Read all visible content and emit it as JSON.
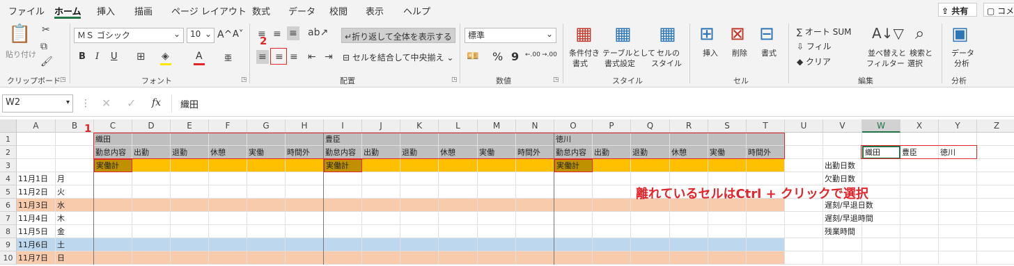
{
  "menu_tabs": [
    "ファイル",
    "ホーム",
    "挿入",
    "描画",
    "ページ レイアウト",
    "数式",
    "データ",
    "校閲",
    "表示",
    "ヘルプ"
  ],
  "share_label": "共有",
  "comment_label": "コメ",
  "ribbon": {
    "clipboard": {
      "paste": "貼り付け",
      "group": "クリップボード"
    },
    "font": {
      "name": "ＭＳ ゴシック",
      "size": "10",
      "group": "フォント",
      "grow": "A^",
      "shrink": "A˅",
      "bold": "B",
      "italic": "I",
      "underline": "U",
      "phonetic": "亜"
    },
    "alignment": {
      "wrap": "折り返して全体を表示する",
      "merge": "セルを結合して中央揃え",
      "group": "配置"
    },
    "number": {
      "format": "標準",
      "group": "数値",
      "percent": "%",
      "comma": "9",
      "inc": ".00",
      "dec": ".00"
    },
    "styles": {
      "cond": [
        "条件付き",
        "書式"
      ],
      "table": [
        "テーブルとして",
        "書式設定"
      ],
      "cell": [
        "セルの",
        "スタイル"
      ],
      "group": "スタイル"
    },
    "cells": {
      "insert": "挿入",
      "delete": "削除",
      "format": "書式",
      "group": "セル"
    },
    "editing": {
      "autosum": "オート SUM",
      "fill": "フィル",
      "clear": "クリア",
      "sort": [
        "並べ替えと",
        "フィルター"
      ],
      "find": [
        "検索と",
        "選択"
      ],
      "group": "編集"
    },
    "analysis": {
      "data": [
        "データ",
        "分析"
      ],
      "group": "分析"
    }
  },
  "annotations": {
    "step1": "1",
    "step2": "2",
    "note": "離れているセルはCtrl + クリックで選択"
  },
  "formula_bar": {
    "name_box": "W2",
    "fx": "fx",
    "content": "織田"
  },
  "grid": {
    "columns": [
      "A",
      "B",
      "C",
      "D",
      "E",
      "F",
      "G",
      "H",
      "I",
      "J",
      "K",
      "L",
      "M",
      "N",
      "O",
      "P",
      "Q",
      "R",
      "S",
      "T",
      "U",
      "V",
      "W",
      "X",
      "Y",
      "Z"
    ],
    "rows": [
      "1",
      "2",
      "3",
      "4",
      "5",
      "6",
      "7",
      "8",
      "9",
      "10"
    ],
    "names": [
      "織田",
      "豊臣",
      "徳川"
    ],
    "headers": [
      "勤怠内容",
      "出勤",
      "退勤",
      "休憩",
      "実働",
      "時間外"
    ],
    "total_label": "実働計",
    "dates": [
      "11月1日",
      "11月2日",
      "11月3日",
      "11月4日",
      "11月5日",
      "11月6日",
      "11月7日"
    ],
    "weekdays": [
      "月",
      "火",
      "水",
      "木",
      "金",
      "土",
      "日"
    ],
    "w2_names": [
      "織田",
      "豊臣",
      "徳川"
    ],
    "v_labels": [
      "出勤日数",
      "欠勤日数",
      "",
      "遅刻/早退日数",
      "遅刻/早退時間",
      "残業時間"
    ]
  },
  "colors": {
    "accent": "#217346",
    "row3": "#ffc000",
    "total_cell": "#bf9000",
    "header_gray": "#bfbfbf",
    "weekend_sat": "#bdd7ee",
    "weekend_sun": "#f8cbad",
    "red": "#e0252b"
  }
}
